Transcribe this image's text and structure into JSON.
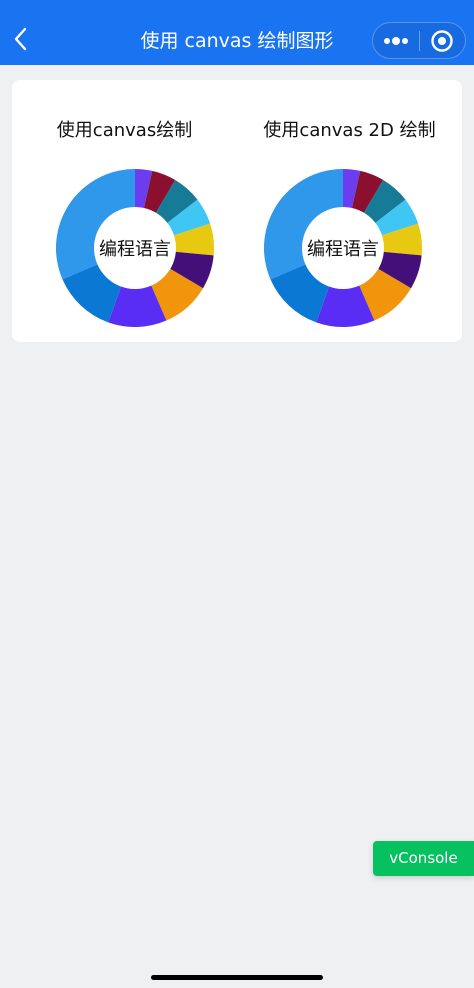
{
  "navbar": {
    "title": "使用 canvas 绘制图形",
    "back_icon": "chevron-left-icon",
    "more_icon": "more-dots-icon",
    "close_icon": "capsule-close-icon",
    "background": "#1a74f2"
  },
  "charts": [
    {
      "title": "使用canvas绘制",
      "center_label": "编程语言"
    },
    {
      "title": "使用canvas 2D 绘制",
      "center_label": "编程语言"
    }
  ],
  "chart_data": [
    {
      "type": "pie",
      "title": "使用canvas绘制",
      "center_label": "编程语言",
      "donut": true,
      "values": [
        3.5,
        5,
        6,
        5.5,
        6.5,
        7,
        10,
        12,
        13,
        31.5
      ],
      "colors": [
        "#6b3df0",
        "#8b0f2e",
        "#177a96",
        "#3fc6f2",
        "#e8c912",
        "#43107a",
        "#f0950c",
        "#5a2df5",
        "#0b78d4",
        "#2f98ea"
      ]
    },
    {
      "type": "pie",
      "title": "使用canvas 2D 绘制",
      "center_label": "编程语言",
      "donut": true,
      "values": [
        3.5,
        5,
        6,
        5.5,
        6.5,
        7,
        10,
        12,
        13,
        31.5
      ],
      "colors": [
        "#6b3df0",
        "#8b0f2e",
        "#177a96",
        "#3fc6f2",
        "#e8c912",
        "#43107a",
        "#f0950c",
        "#5a2df5",
        "#0b78d4",
        "#2f98ea"
      ]
    }
  ],
  "vconsole": {
    "label": "vConsole",
    "color": "#07c160"
  }
}
